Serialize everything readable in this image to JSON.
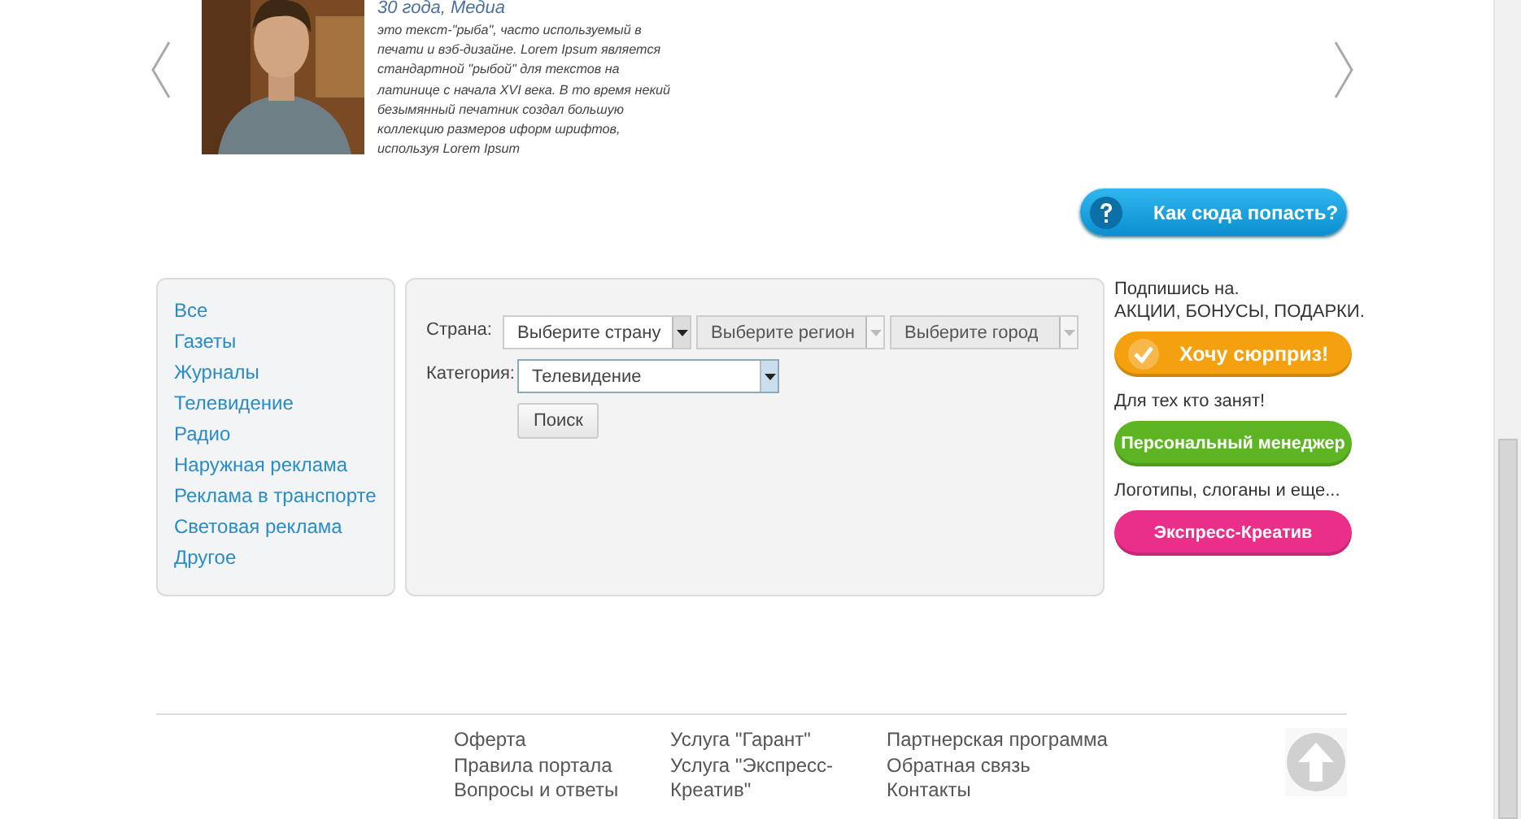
{
  "carousel": {
    "caption": "30 года, Медиа",
    "text": "это текст-\"рыба\", часто используемый в печати и вэб-дизайне. Lorem Ipsum является стандартной \"рыбой\" для текстов на латинице с начала XVI века. В то время некий безымянный печатник создал большую коллекцию размеров иформ шрифтов, используя Lorem Ipsum"
  },
  "directions_button": {
    "label": "Как сюда попасть?"
  },
  "categories": [
    {
      "label": "Все"
    },
    {
      "label": "Газеты"
    },
    {
      "label": "Журналы"
    },
    {
      "label": "Телевидение"
    },
    {
      "label": "Радио"
    },
    {
      "label": "Наружная реклама"
    },
    {
      "label": "Реклама в транспорте"
    },
    {
      "label": "Световая реклама"
    },
    {
      "label": "Другое"
    }
  ],
  "filter": {
    "country_label": "Страна:",
    "selects": [
      {
        "value": "Выберите страну",
        "disabled": false
      },
      {
        "value": "Выберите регион",
        "disabled": true
      },
      {
        "value": "Выберите город",
        "disabled": true
      }
    ],
    "category_label": "Категория:",
    "category": {
      "value": "Телевидение",
      "disabled": false
    },
    "search_button": "Поиск"
  },
  "promos": [
    {
      "text": "Подпишись на.",
      "text2": "АКЦИИ, БОНУСЫ, ПОДАРКИ.",
      "button": "Хочу сюрприз!",
      "color": "#f5a00f",
      "icon": true
    },
    {
      "text": "Для тех кто занят!",
      "button": "Персональный менеджер",
      "color": "#5eb524",
      "icon": false
    },
    {
      "text": "Логотипы, слоганы и еще...",
      "button": "Экспресс-Креатив",
      "color": "#ea2f8a",
      "icon": false
    }
  ],
  "footer": {
    "columns": [
      [
        "Оферта",
        "Правила портала",
        "Вопросы и ответы"
      ],
      [
        "Услуга \"Гарант\"",
        "Услуга \"Экспресс-Креатив\""
      ],
      [
        "Партнерская программа",
        "Обратная связь",
        "Контакты"
      ]
    ]
  }
}
